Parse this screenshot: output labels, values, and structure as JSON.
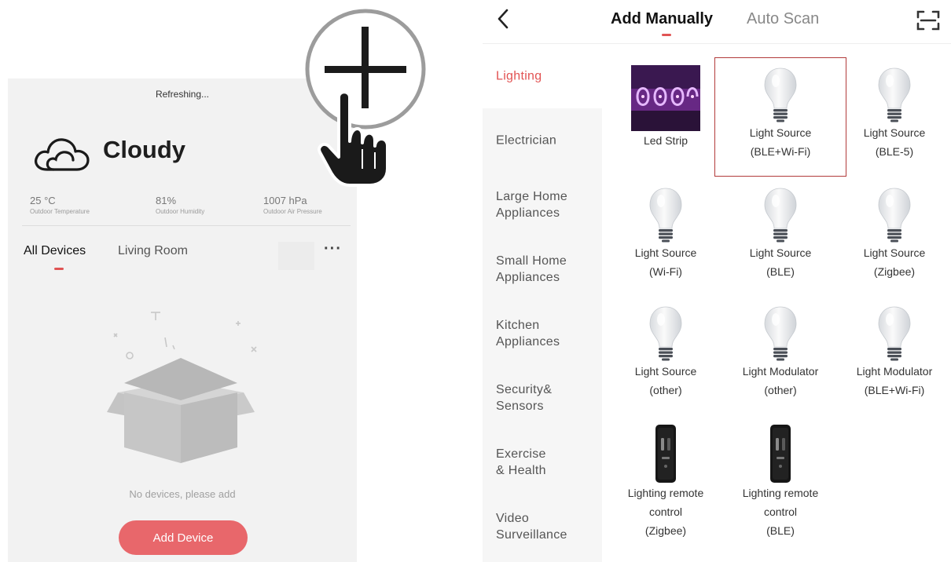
{
  "home": {
    "refresh_text": "Refreshing...",
    "weather": {
      "icon": "cloud-icon",
      "condition": "Cloudy",
      "stats": [
        {
          "value": "25 °C",
          "label": "Outdoor Temperature"
        },
        {
          "value": "81%",
          "label": "Outdoor Humidity"
        },
        {
          "value": "1007 hPa",
          "label": "Outdoor Air Pressure"
        }
      ]
    },
    "rooms": [
      "All Devices",
      "Living Room"
    ],
    "more_label": "···",
    "empty_message": "No devices, please add",
    "add_button": "Add Device"
  },
  "add_device": {
    "tabs": [
      "Add Manually",
      "Auto Scan"
    ],
    "categories": [
      "Lighting",
      "Electrician",
      "Large Home\nAppliances",
      "Small Home\nAppliances",
      "Kitchen\nAppliances",
      "Security&\nSensors",
      "Exercise\n& Health",
      "Video\nSurveillance"
    ],
    "active_category": "Lighting",
    "devices": [
      {
        "name": "Led Strip",
        "icon": "led-strip-icon"
      },
      {
        "name": "Light Source\n(BLE+Wi-Fi)",
        "icon": "bulb-icon",
        "selected": true
      },
      {
        "name": "Light Source\n(BLE-5)",
        "icon": "bulb-icon"
      },
      {
        "name": "Light Source\n(Wi-Fi)",
        "icon": "bulb-icon"
      },
      {
        "name": "Light Source\n(BLE)",
        "icon": "bulb-icon"
      },
      {
        "name": "Light Source\n(Zigbee)",
        "icon": "bulb-icon"
      },
      {
        "name": "Light Source\n(other)",
        "icon": "bulb-icon"
      },
      {
        "name": "Light Modulator\n(other)",
        "icon": "bulb-icon"
      },
      {
        "name": "Light Modulator\n(BLE+Wi-Fi)",
        "icon": "bulb-icon"
      },
      {
        "name": "Lighting remote\ncontrol\n(Zigbee)",
        "icon": "remote-icon"
      },
      {
        "name": "Lighting remote\ncontrol\n(BLE)",
        "icon": "remote-icon"
      }
    ]
  },
  "colors": {
    "accent": "#e05454",
    "button": "#e8676b",
    "selection": "#b23b3b"
  }
}
